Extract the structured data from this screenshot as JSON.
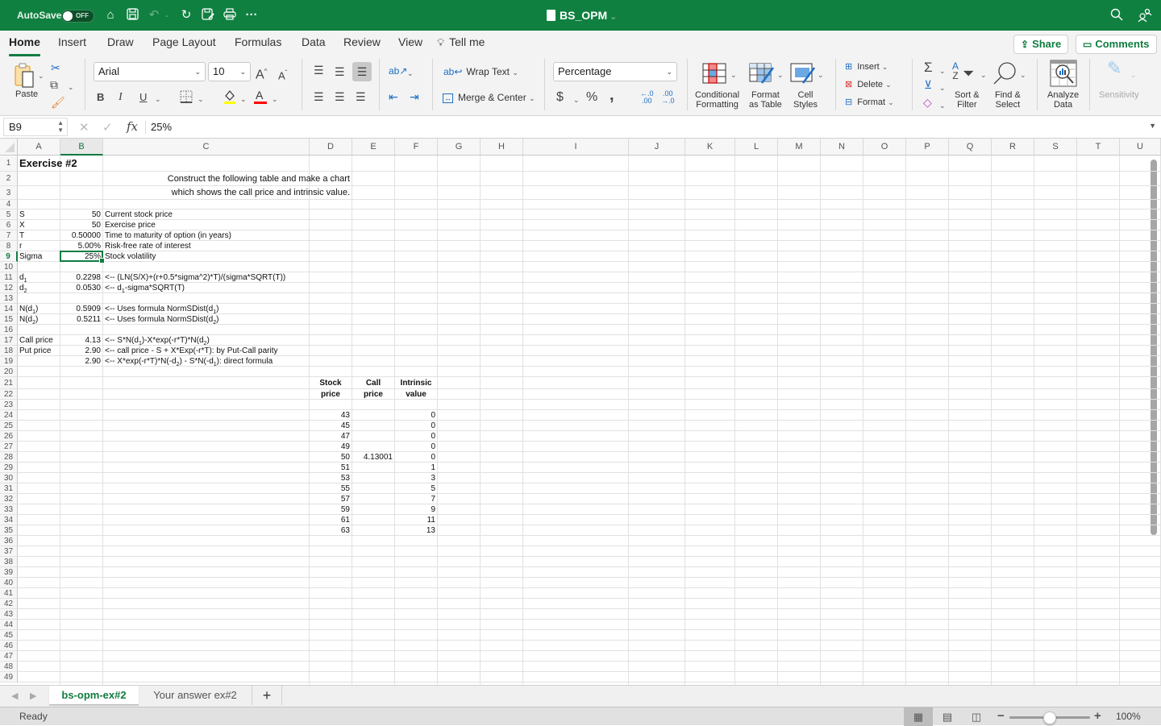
{
  "titlebar": {
    "autosave_label": "AutoSave",
    "autosave_state": "OFF",
    "document_title": "BS_OPM",
    "icons": [
      "home-icon",
      "save-icon",
      "undo-icon",
      "redo-icon",
      "save-as-icon",
      "print-icon",
      "more-icon"
    ],
    "right_icons": [
      "search-icon",
      "share-people-icon"
    ]
  },
  "ribbon": {
    "tabs": [
      "Home",
      "Insert",
      "Draw",
      "Page Layout",
      "Formulas",
      "Data",
      "Review",
      "View"
    ],
    "active_tab": "Home",
    "tell_me": "Tell me",
    "share_label": "Share",
    "comments_label": "Comments",
    "clipboard": {
      "paste": "Paste"
    },
    "font": {
      "name": "Arial",
      "size": "10",
      "bold": "B",
      "italic": "I",
      "underline": "U",
      "fill_color": "#ffff00",
      "font_color": "#ff0000"
    },
    "alignment": {
      "wrap_text": "Wrap Text",
      "merge_center": "Merge & Center"
    },
    "number": {
      "format": "Percentage",
      "currency": "$",
      "percent": "%",
      "comma": ","
    },
    "styles": {
      "conditional_formatting": [
        "Conditional",
        "Formatting"
      ],
      "format_as_table": [
        "Format",
        "as Table"
      ],
      "cell_styles": [
        "Cell",
        "Styles"
      ]
    },
    "cells": {
      "insert": "Insert",
      "delete": "Delete",
      "format": "Format"
    },
    "editing": {
      "sort_filter": [
        "Sort &",
        "Filter"
      ],
      "find_select": [
        "Find &",
        "Select"
      ]
    },
    "analyze_data": [
      "Analyze",
      "Data"
    ],
    "sensitivity": "Sensitivity"
  },
  "formula_bar": {
    "name_box": "B9",
    "fx": "fx",
    "value": "25%"
  },
  "sheet": {
    "selected_cell": "B9",
    "selected_column": "B",
    "selected_row": "9",
    "columns": [
      "A",
      "B",
      "C",
      "D",
      "E",
      "F",
      "G",
      "H",
      "I",
      "J",
      "K",
      "L",
      "M",
      "N",
      "O",
      "P",
      "Q",
      "R",
      "S",
      "T",
      "U"
    ],
    "row_numbers": [
      "1",
      "2",
      "3",
      "4",
      "5",
      "6",
      "7",
      "8",
      "9",
      "10",
      "11",
      "12",
      "13",
      "14",
      "15",
      "16",
      "17",
      "18",
      "19",
      "20",
      "21",
      "22",
      "23",
      "24",
      "25",
      "26",
      "27",
      "28",
      "29",
      "30",
      "31",
      "32",
      "33",
      "34",
      "35",
      "36",
      "37",
      "38",
      "39",
      "40",
      "41",
      "42",
      "43",
      "44",
      "45",
      "46",
      "47",
      "48",
      "49"
    ],
    "title": "Exercise #2",
    "instructions": [
      "Construct the following table and make a chart",
      "which shows the call price and intrinsic value."
    ],
    "inputs": [
      {
        "label": "S",
        "value": "50",
        "desc": "Current stock price"
      },
      {
        "label": "X",
        "value": "50",
        "desc": "Exercise price"
      },
      {
        "label": "T",
        "value": "0.50000",
        "desc": "Time to maturity of option (in years)"
      },
      {
        "label": "r",
        "value": "5.00%",
        "desc": "Risk-free rate of interest"
      },
      {
        "label": "Sigma",
        "value": "25%",
        "desc": "Stock volatility"
      }
    ],
    "d_values": [
      {
        "label": "d1",
        "value": "0.2298",
        "desc": "<-- (LN(S/X)+(r+0.5*sigma^2)*T)/(sigma*SQRT(T))"
      },
      {
        "label": "d2",
        "value": "0.0530",
        "desc": "<-- d1-sigma*SQRT(T)"
      }
    ],
    "n_values": [
      {
        "label": "N(d1)",
        "value": "0.5909",
        "desc": "<-- Uses formula NormSDist(d1)"
      },
      {
        "label": "N(d2)",
        "value": "0.5211",
        "desc": "<-- Uses formula NormSDist(d2)"
      }
    ],
    "prices": [
      {
        "label": "Call price",
        "value": "4.13",
        "desc": "<-- S*N(d1)-X*exp(-r*T)*N(d2)"
      },
      {
        "label": "Put price",
        "value": "2.90",
        "desc": "<-- call price - S + X*Exp(-r*T):  by Put-Call parity"
      },
      {
        "label": "",
        "value": "2.90",
        "desc": "<-- X*exp(-r*T)*N(-d2) - S*N(-d1):  direct formula"
      }
    ],
    "table_headers": [
      [
        "Stock",
        "price"
      ],
      [
        "Call",
        "price"
      ],
      [
        "Intrinsic",
        "value"
      ]
    ],
    "table_rows": [
      {
        "stock": "43",
        "call": "",
        "intrinsic": "0"
      },
      {
        "stock": "45",
        "call": "",
        "intrinsic": "0"
      },
      {
        "stock": "47",
        "call": "",
        "intrinsic": "0"
      },
      {
        "stock": "49",
        "call": "",
        "intrinsic": "0"
      },
      {
        "stock": "50",
        "call": "4.13001",
        "intrinsic": "0"
      },
      {
        "stock": "51",
        "call": "",
        "intrinsic": "1"
      },
      {
        "stock": "53",
        "call": "",
        "intrinsic": "3"
      },
      {
        "stock": "55",
        "call": "",
        "intrinsic": "5"
      },
      {
        "stock": "57",
        "call": "",
        "intrinsic": "7"
      },
      {
        "stock": "59",
        "call": "",
        "intrinsic": "9"
      },
      {
        "stock": "61",
        "call": "",
        "intrinsic": "11"
      },
      {
        "stock": "63",
        "call": "",
        "intrinsic": "13"
      }
    ]
  },
  "sheet_tabs": [
    {
      "label": "bs-opm-ex#2",
      "active": true
    },
    {
      "label": "Your answer  ex#2",
      "active": false
    }
  ],
  "add_sheet": "+",
  "status": {
    "text": "Ready",
    "zoom": "100%",
    "zoom_percent": 100
  }
}
